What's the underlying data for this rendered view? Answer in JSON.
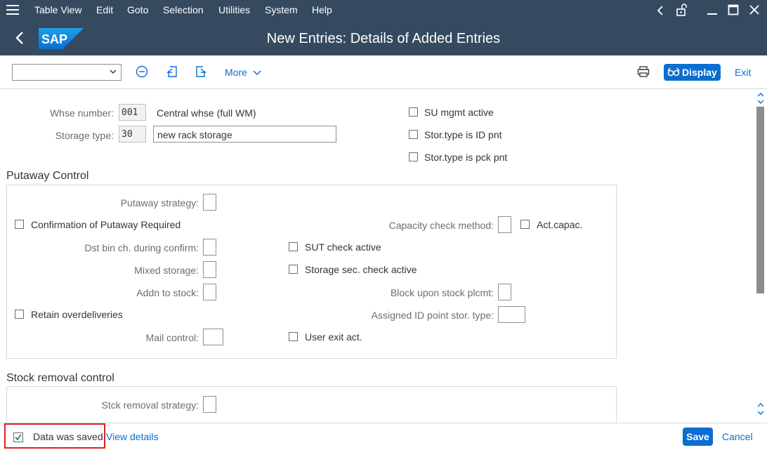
{
  "menubar": {
    "items": [
      "Table View",
      "Edit",
      "Goto",
      "Selection",
      "Utilities",
      "System",
      "Help"
    ]
  },
  "titlebar": {
    "title": "New Entries: Details of Added Entries",
    "logo_text": "SAP"
  },
  "toolbar": {
    "command_field_value": "",
    "more_label": "More",
    "display_label": "Display",
    "exit_label": "Exit"
  },
  "header": {
    "whse_number_label": "Whse number:",
    "whse_number_value": "001",
    "whse_number_desc": "Central whse (full WM)",
    "storage_type_label": "Storage type:",
    "storage_type_value": "30",
    "storage_type_desc": "new rack storage",
    "su_mgmt_label": "SU mgmt active",
    "id_pnt_label": "Stor.type is ID pnt",
    "pck_pnt_label": "Stor.type is pck pnt"
  },
  "putaway": {
    "title": "Putaway Control",
    "putaway_strategy_label": "Putaway strategy:",
    "confirmation_label": "Confirmation of Putaway Required",
    "capacity_check_label": "Capacity check method:",
    "act_capac_label": "Act.capac.",
    "dst_bin_label": "Dst bin ch. during confirm:",
    "sut_check_label": "SUT check active",
    "mixed_storage_label": "Mixed storage:",
    "storage_sec_label": "Storage sec. check active",
    "addn_stock_label": "Addn to stock:",
    "block_upon_label": "Block upon stock plcmt:",
    "retain_over_label": "Retain overdeliveries",
    "assigned_id_label": "Assigned ID point stor. type:",
    "mail_control_label": "Mail control:",
    "user_exit_label": "User exit act."
  },
  "stock_removal": {
    "title": "Stock removal control",
    "strategy_label": "Stck removal strategy:"
  },
  "footer": {
    "status_text": "Data was saved",
    "view_details_label": "View details",
    "save_label": "Save",
    "cancel_label": "Cancel"
  },
  "colors": {
    "shell_bar": "#354a5f",
    "accent": "#0a6ed1",
    "status_highlight": "#e02020"
  }
}
